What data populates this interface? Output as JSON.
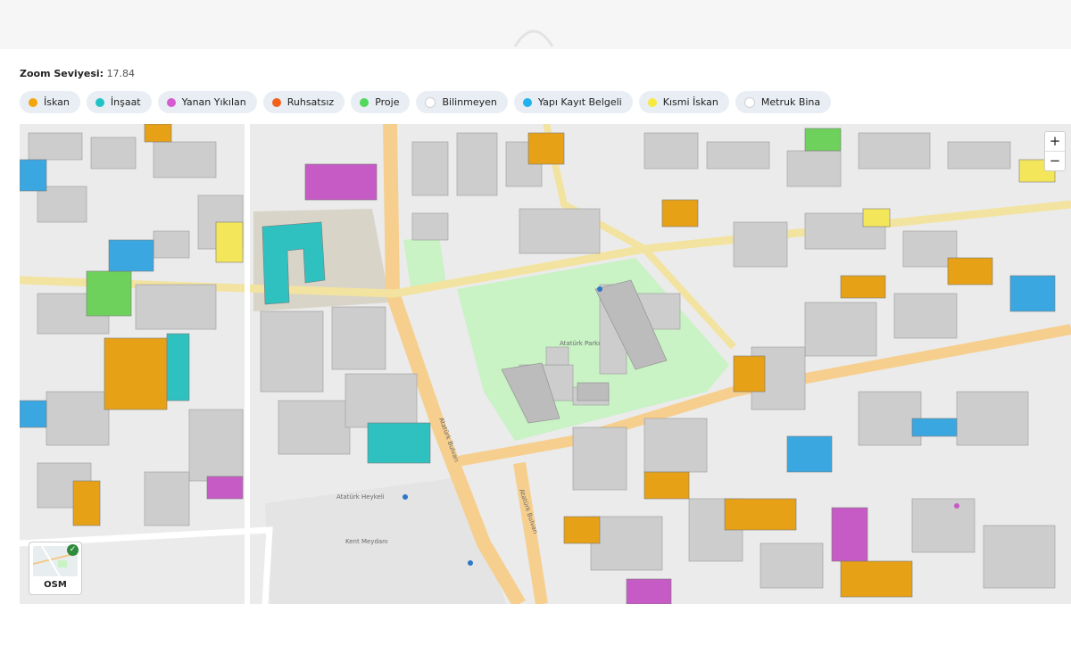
{
  "zoom": {
    "label": "Zoom Seviyesi:",
    "value": "17.84"
  },
  "legend": [
    {
      "id": "iskan",
      "label": "İskan",
      "color": "#f2a60c"
    },
    {
      "id": "insaat",
      "label": "İnşaat",
      "color": "#22c3c5"
    },
    {
      "id": "yanan",
      "label": "Yanan Yıkılan",
      "color": "#d65bd1"
    },
    {
      "id": "ruhsatsiz",
      "label": "Ruhsatsız",
      "color": "#f2601c"
    },
    {
      "id": "proje",
      "label": "Proje",
      "color": "#52d85a"
    },
    {
      "id": "bilinmeyen",
      "label": "Bilinmeyen",
      "color": "#ffffff"
    },
    {
      "id": "yapi",
      "label": "Yapı Kayıt Belgeli",
      "color": "#20b1ee"
    },
    {
      "id": "kismi",
      "label": "Kısmi İskan",
      "color": "#f7e93e"
    },
    {
      "id": "metruk",
      "label": "Metruk Bina",
      "color": "#ffffff"
    }
  ],
  "map": {
    "zoom_in": "+",
    "zoom_out": "−",
    "basemap_label": "OSM",
    "labels": {
      "park": "Atatürk Parkı",
      "square": "Kent Meydanı",
      "monument": "Atatürk Heykeli",
      "street_a": "Atatürk Bulvarı",
      "street_b": "Atatürk Bulvarı"
    }
  }
}
